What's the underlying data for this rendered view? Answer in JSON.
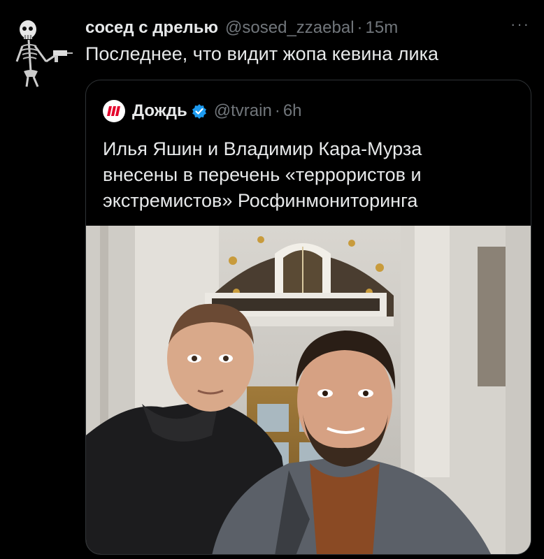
{
  "tweet": {
    "display_name": "сосед с дрелью",
    "handle": "@sosed_zzaebal",
    "separator": "·",
    "time": "15m",
    "more_label": "···",
    "text": "Последнее, что видит жопа кевина лика"
  },
  "quote": {
    "display_name": "Дождь",
    "handle": "@tvrain",
    "separator": "·",
    "time": "6h",
    "text_lines": [
      "Илья Яшин и Владимир Кара-Мурза",
      "внесены в перечень «террористов и",
      "экстремистов» Росфинмониторинга"
    ],
    "verified_color": "#1d9bf0",
    "logo_color": "#e4002b"
  },
  "icons": {
    "avatar": "skeleton-avatar-icon",
    "verified": "verified-badge-icon",
    "logo": "tvrain-logo-icon",
    "more": "more-icon"
  }
}
